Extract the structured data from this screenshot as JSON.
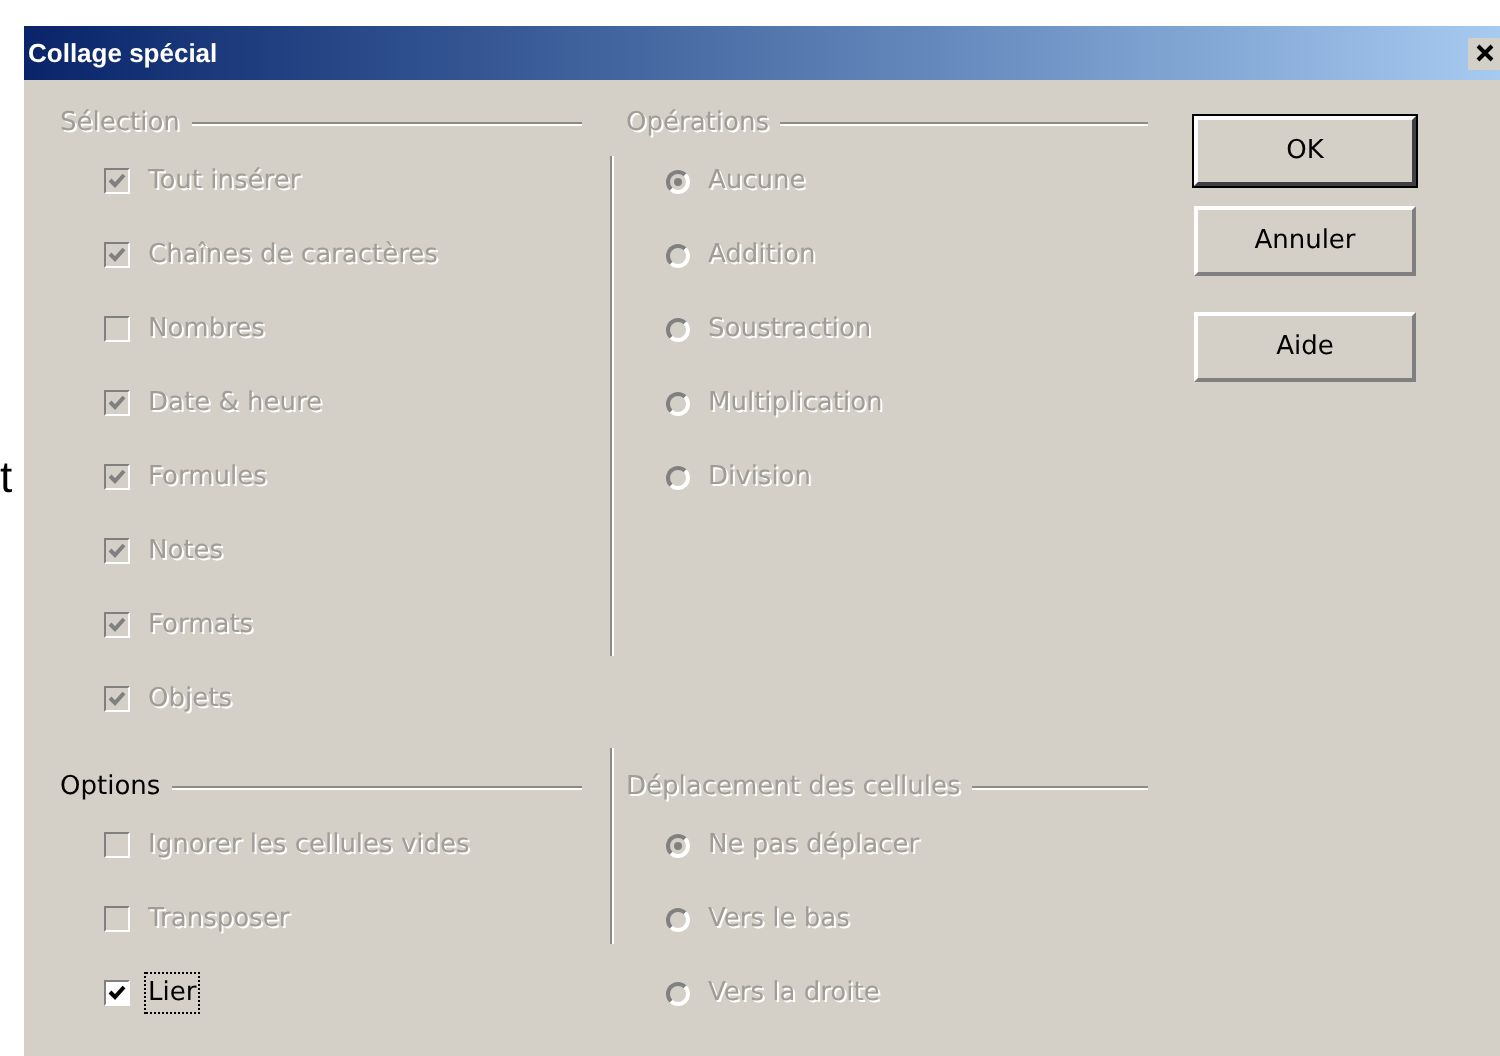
{
  "background_text": "t",
  "window": {
    "title": "Collage spécial"
  },
  "selection": {
    "title": "Sélection",
    "disabled": true,
    "items": [
      {
        "label": "Tout insérer",
        "checked": true,
        "disabled": true
      },
      {
        "label": "Chaînes de caractères",
        "checked": true,
        "disabled": true
      },
      {
        "label": "Nombres",
        "checked": false,
        "disabled": true
      },
      {
        "label": "Date & heure",
        "checked": true,
        "disabled": true
      },
      {
        "label": "Formules",
        "checked": true,
        "disabled": true
      },
      {
        "label": "Notes",
        "checked": true,
        "disabled": true
      },
      {
        "label": "Formats",
        "checked": true,
        "disabled": true
      },
      {
        "label": "Objets",
        "checked": true,
        "disabled": true
      }
    ]
  },
  "operations": {
    "title": "Opérations",
    "disabled": true,
    "items": [
      {
        "label": "Aucune",
        "selected": true,
        "disabled": true
      },
      {
        "label": "Addition",
        "selected": false,
        "disabled": true
      },
      {
        "label": "Soustraction",
        "selected": false,
        "disabled": true
      },
      {
        "label": "Multiplication",
        "selected": false,
        "disabled": true
      },
      {
        "label": "Division",
        "selected": false,
        "disabled": true
      }
    ]
  },
  "buttons": [
    {
      "label": "OK",
      "default": true
    },
    {
      "label": "Annuler",
      "default": false
    },
    {
      "label": "Aide",
      "default": false
    }
  ],
  "options": {
    "title": "Options",
    "disabled": false,
    "items": [
      {
        "label": "Ignorer les cellules vides",
        "checked": false,
        "disabled": true,
        "focused": false
      },
      {
        "label": "Transposer",
        "checked": false,
        "disabled": true,
        "focused": false
      },
      {
        "label": "Lier",
        "checked": true,
        "disabled": false,
        "focused": true
      }
    ]
  },
  "cell_shift": {
    "title": "Déplacement des cellules",
    "disabled": true,
    "items": [
      {
        "label": "Ne pas déplacer",
        "selected": true,
        "disabled": true
      },
      {
        "label": "Vers le bas",
        "selected": false,
        "disabled": true
      },
      {
        "label": "Vers la droite",
        "selected": false,
        "disabled": true
      }
    ]
  }
}
